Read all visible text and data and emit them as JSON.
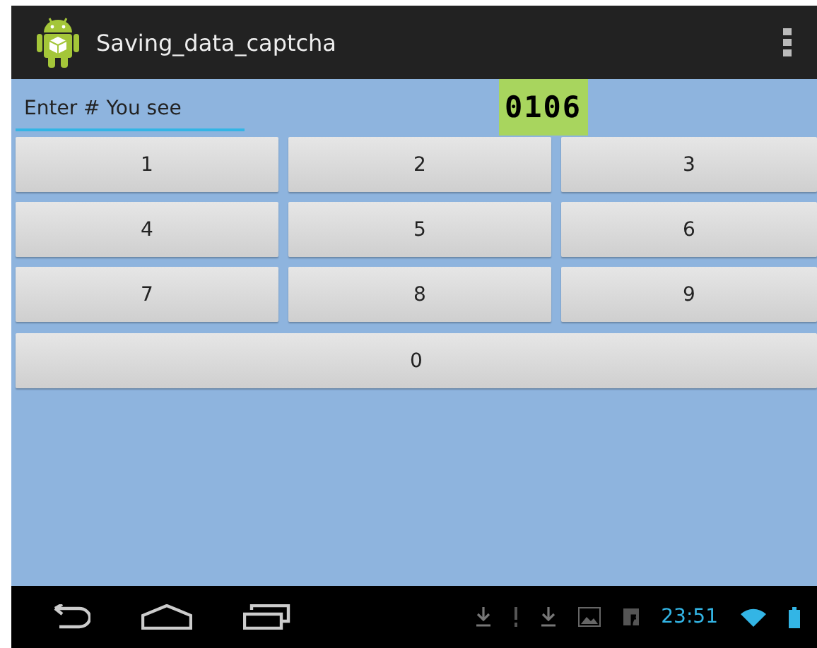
{
  "action_bar": {
    "title": "Saving_data_captcha"
  },
  "answer_field": {
    "placeholder": "Enter # You see"
  },
  "captcha": {
    "text": "0106"
  },
  "keypad": [
    {
      "label": "1",
      "kind": "digit"
    },
    {
      "label": "2",
      "kind": "digit"
    },
    {
      "label": "3",
      "kind": "digit"
    },
    {
      "label": "4",
      "kind": "digit"
    },
    {
      "label": "5",
      "kind": "digit"
    },
    {
      "label": "6",
      "kind": "digit"
    },
    {
      "label": "7",
      "kind": "digit"
    },
    {
      "label": "8",
      "kind": "digit"
    },
    {
      "label": "9",
      "kind": "digit"
    },
    {
      "label": "0",
      "kind": "wide"
    }
  ],
  "system_bar": {
    "time": "23:51"
  }
}
